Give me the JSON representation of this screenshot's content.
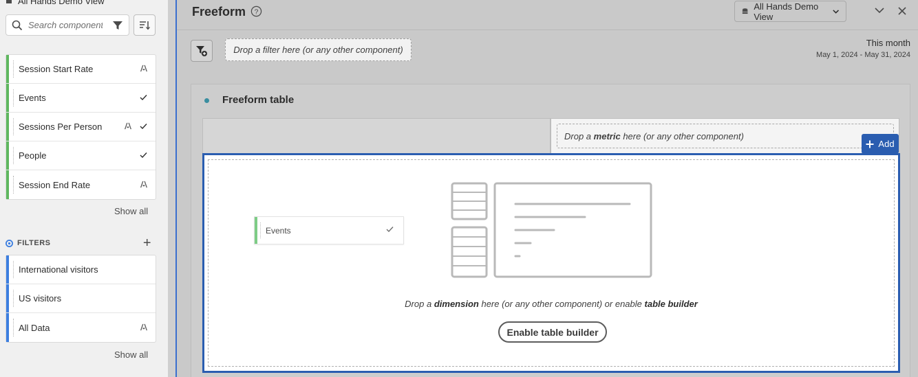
{
  "rail": {
    "data_view_title": "All Hands Demo View",
    "search_placeholder": "Search components",
    "metrics": [
      {
        "label": "Session Start Rate",
        "adobe": true,
        "curated": false
      },
      {
        "label": "Events",
        "adobe": false,
        "curated": true
      },
      {
        "label": "Sessions Per Person",
        "adobe": true,
        "curated": true
      },
      {
        "label": "People",
        "adobe": false,
        "curated": true
      },
      {
        "label": "Session End Rate",
        "adobe": true,
        "curated": false
      }
    ],
    "metrics_show_all": "Show all",
    "filters_header": "FILTERS",
    "filters": [
      {
        "label": "International visitors",
        "adobe": false
      },
      {
        "label": "US visitors",
        "adobe": false
      },
      {
        "label": "All Data",
        "adobe": true
      }
    ],
    "filters_show_all": "Show all"
  },
  "panel": {
    "title": "Freeform",
    "data_view_select": "All Hands Demo View",
    "filter_drop": "Drop a filter here (or any other component)",
    "date_title": "This month",
    "date_range": "May 1, 2024 - May 31, 2024"
  },
  "viz": {
    "title": "Freeform table",
    "metric_drop_pre": "Drop a",
    "metric_drop_bold": "metric",
    "metric_drop_post": "here (or any other component)",
    "add_label": "Add",
    "dragged_chip": "Events",
    "dim_pre": "Drop a",
    "dim_bold1": "dimension",
    "dim_mid": "here (or any other component) or enable",
    "dim_bold2": "table builder",
    "enable_button": "Enable table builder"
  },
  "colors": {
    "accent_blue": "#2a5db0",
    "metric_green": "#5fb75f",
    "filter_blue": "#3d7fe0"
  }
}
